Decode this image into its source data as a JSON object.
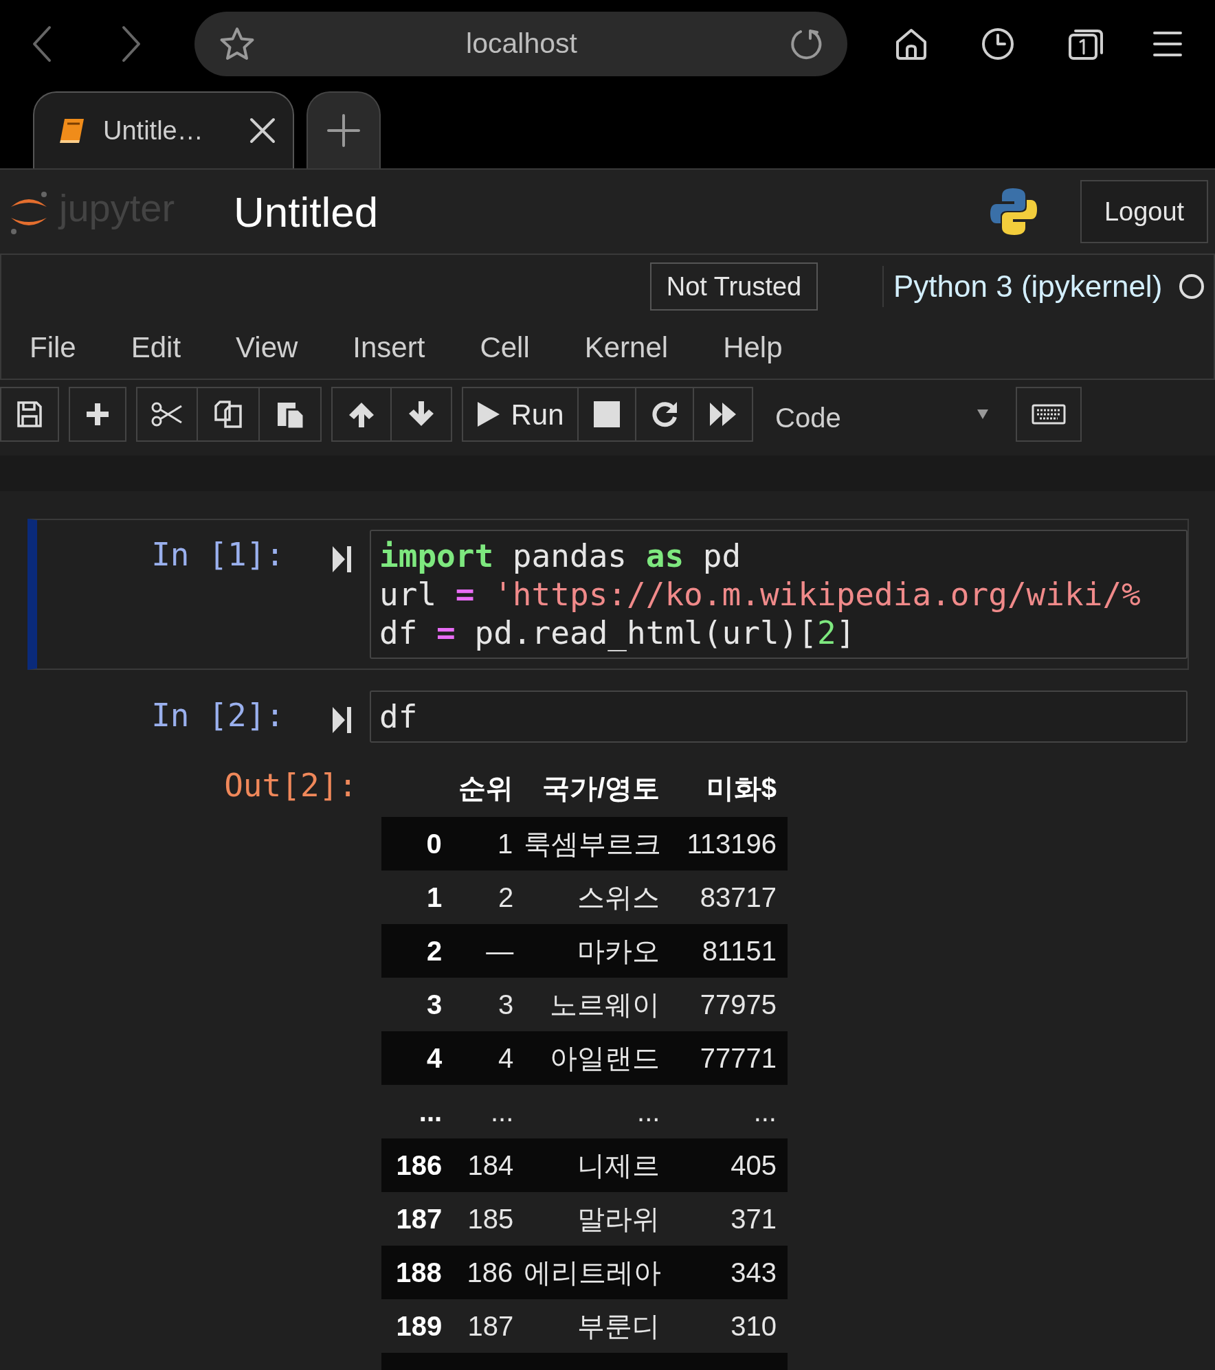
{
  "browser": {
    "url": "localhost",
    "tab": {
      "title": "Untitle…",
      "selected": true
    }
  },
  "header": {
    "logo": "jupyter",
    "title": "Untitled",
    "logout": "Logout"
  },
  "notebook_status": {
    "trust": "Not Trusted",
    "kernel": "Python 3 (ipykernel)"
  },
  "menu": [
    "File",
    "Edit",
    "View",
    "Insert",
    "Cell",
    "Kernel",
    "Help"
  ],
  "toolbar": {
    "run_label": "Run",
    "cell_type": "Code"
  },
  "cells": [
    {
      "prompt": "In [1]:",
      "selected": true,
      "lines": [
        [
          {
            "kind": "keyword",
            "text": "import"
          },
          {
            "kind": "plain",
            "text": " pandas "
          },
          {
            "kind": "keyword",
            "text": "as"
          },
          {
            "kind": "plain",
            "text": " pd"
          }
        ],
        [
          {
            "kind": "plain",
            "text": "url "
          },
          {
            "kind": "operator",
            "text": "="
          },
          {
            "kind": "string",
            "text": " 'https://ko.m.wikipedia.org/wiki/%"
          }
        ],
        [
          {
            "kind": "plain",
            "text": "df "
          },
          {
            "kind": "operator",
            "text": "="
          },
          {
            "kind": "plain",
            "text": " pd.read_html(url)["
          },
          {
            "kind": "number",
            "text": "2"
          },
          {
            "kind": "plain",
            "text": "]"
          }
        ]
      ]
    },
    {
      "prompt": "In [2]:",
      "selected": false,
      "lines": [
        [
          {
            "kind": "plain",
            "text": "df"
          }
        ]
      ]
    }
  ],
  "output": {
    "prompt": "Out[2]:",
    "table": {
      "columns": [
        "순위",
        "국가/영토",
        "미화$"
      ],
      "rows": [
        {
          "index": "0",
          "cells": [
            "1",
            "룩셈부르크",
            "113196"
          ]
        },
        {
          "index": "1",
          "cells": [
            "2",
            "스위스",
            "83717"
          ]
        },
        {
          "index": "2",
          "cells": [
            "—",
            "마카오",
            "81151"
          ]
        },
        {
          "index": "3",
          "cells": [
            "3",
            "노르웨이",
            "77975"
          ]
        },
        {
          "index": "4",
          "cells": [
            "4",
            "아일랜드",
            "77771"
          ]
        },
        {
          "index": "...",
          "cells": [
            "...",
            "...",
            "..."
          ]
        },
        {
          "index": "186",
          "cells": [
            "184",
            "니제르",
            "405"
          ]
        },
        {
          "index": "187",
          "cells": [
            "185",
            "말라위",
            "371"
          ]
        },
        {
          "index": "188",
          "cells": [
            "186",
            "에리트레아",
            "343"
          ]
        },
        {
          "index": "189",
          "cells": [
            "187",
            "부룬디",
            "310"
          ]
        }
      ]
    }
  }
}
